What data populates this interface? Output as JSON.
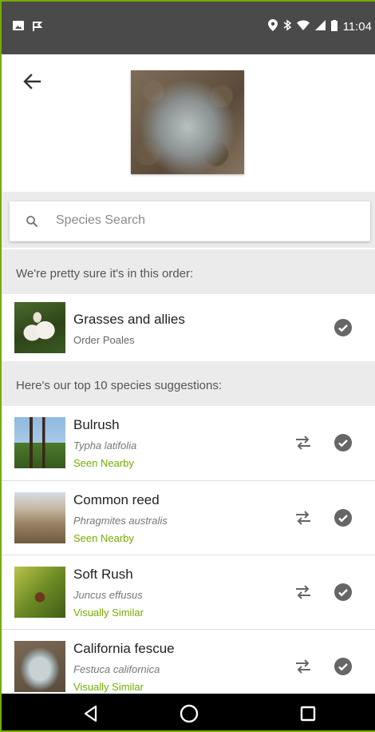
{
  "status_bar": {
    "time": "11:04"
  },
  "search": {
    "placeholder": "Species Search"
  },
  "order_section": {
    "heading": "We're pretty sure it's in this order:",
    "item": {
      "name": "Grasses and allies",
      "rank": "Order Poales"
    }
  },
  "species_section": {
    "heading": "Here's our top 10 species suggestions:",
    "items": [
      {
        "name": "Bulrush",
        "scientific": "Typha latifolia",
        "tag": "Seen Nearby"
      },
      {
        "name": "Common reed",
        "scientific": "Phragmites australis",
        "tag": "Seen Nearby"
      },
      {
        "name": "Soft Rush",
        "scientific": "Juncus effusus",
        "tag": "Visually Similar"
      },
      {
        "name": "California fescue",
        "scientific": "Festuca californica",
        "tag": "Visually Similar"
      }
    ]
  },
  "colors": {
    "accent": "#74ac00",
    "status_bar": "#4a4a4a",
    "section_bg": "#ebebeb"
  },
  "icons": [
    "back-arrow-icon",
    "search-icon",
    "compare-icon",
    "check-circle-icon",
    "nav-back-icon",
    "nav-home-icon",
    "nav-recents-icon"
  ]
}
